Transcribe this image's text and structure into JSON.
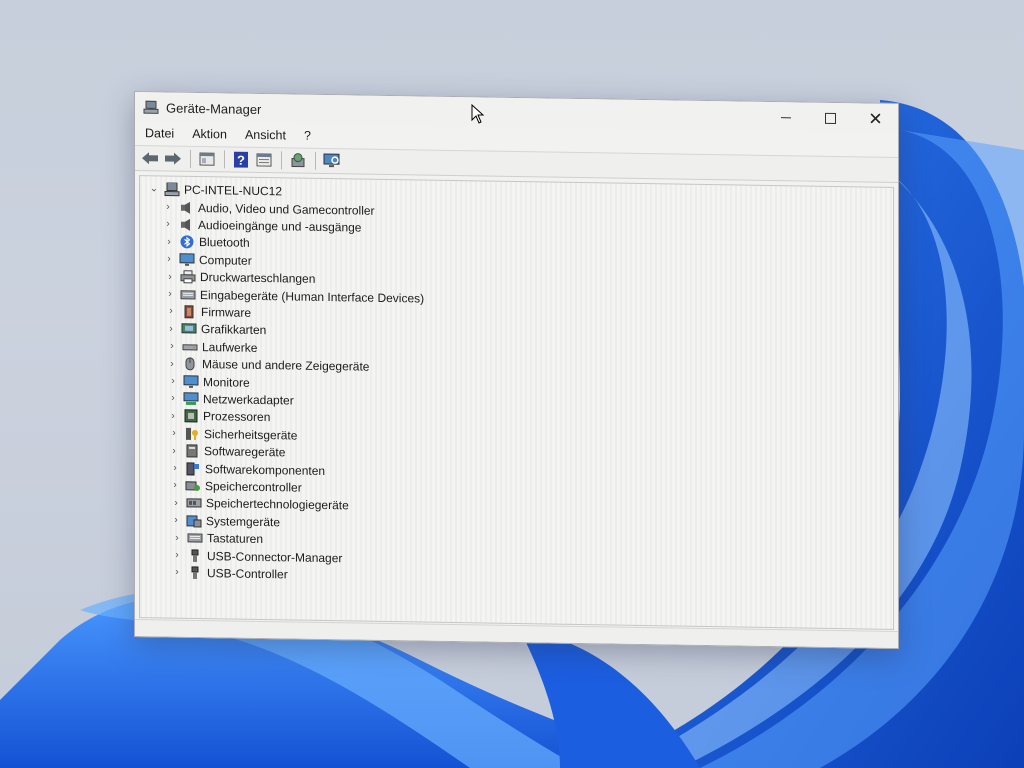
{
  "window": {
    "title": "Geräte-Manager",
    "minimize_icon": "minimize-icon",
    "maximize_icon": "maximize-icon",
    "close_icon": "close-icon"
  },
  "menu": [
    "Datei",
    "Aktion",
    "Ansicht",
    "?"
  ],
  "toolbar": [
    "back-arrow-icon",
    "forward-arrow-icon",
    "properties-icon",
    "help-icon",
    "view-icon",
    "update-driver-icon",
    "scan-hardware-icon"
  ],
  "tree": {
    "root": "PC-INTEL-NUC12",
    "items": [
      {
        "label": "Audio, Video und Gamecontroller",
        "icon": "speaker-icon"
      },
      {
        "label": "Audioeingänge und -ausgänge",
        "icon": "speaker-icon"
      },
      {
        "label": "Bluetooth",
        "icon": "bluetooth-icon"
      },
      {
        "label": "Computer",
        "icon": "monitor-icon"
      },
      {
        "label": "Druckwarteschlangen",
        "icon": "printer-icon"
      },
      {
        "label": "Eingabegeräte (Human Interface Devices)",
        "icon": "keyboard-icon"
      },
      {
        "label": "Firmware",
        "icon": "chip-icon"
      },
      {
        "label": "Grafikkarten",
        "icon": "display-adapter-icon"
      },
      {
        "label": "Laufwerke",
        "icon": "drive-icon"
      },
      {
        "label": "Mäuse und andere Zeigegeräte",
        "icon": "mouse-icon"
      },
      {
        "label": "Monitore",
        "icon": "monitor-icon"
      },
      {
        "label": "Netzwerkadapter",
        "icon": "network-icon"
      },
      {
        "label": "Prozessoren",
        "icon": "processor-icon"
      },
      {
        "label": "Sicherheitsgeräte",
        "icon": "security-key-icon"
      },
      {
        "label": "Softwaregeräte",
        "icon": "software-device-icon"
      },
      {
        "label": "Softwarekomponenten",
        "icon": "software-component-icon"
      },
      {
        "label": "Speichercontroller",
        "icon": "storage-controller-icon"
      },
      {
        "label": "Speichertechnologiegeräte",
        "icon": "memory-device-icon"
      },
      {
        "label": "Systemgeräte",
        "icon": "system-device-icon"
      },
      {
        "label": "Tastaturen",
        "icon": "keyboard-icon"
      },
      {
        "label": "USB-Connector-Manager",
        "icon": "usb-icon"
      },
      {
        "label": "USB-Controller",
        "icon": "usb-icon"
      }
    ]
  }
}
